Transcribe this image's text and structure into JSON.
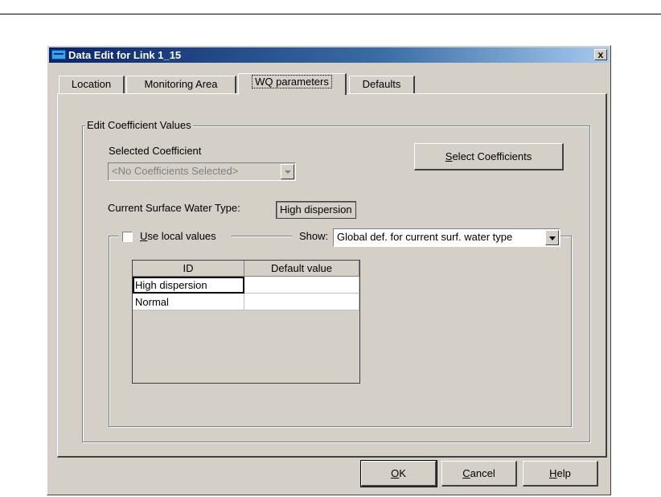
{
  "window": {
    "title": "Data Edit for Link 1_15",
    "close_label": "x"
  },
  "tabs": [
    {
      "label": "Location"
    },
    {
      "label": "Monitoring Area"
    },
    {
      "label": "WQ parameters"
    },
    {
      "label": "Defaults"
    }
  ],
  "active_tab": "WQ parameters",
  "edit_group": {
    "label": "Edit Coefficient Values"
  },
  "selected_coefficient": {
    "label": "Selected Coefficient",
    "value": "<No Coefficients Selected>"
  },
  "select_coefficients_button": {
    "mnemonic": "S",
    "rest": "elect Coefficients"
  },
  "surface_type": {
    "label": "Current Surface Water Type:",
    "value": "High dispersion"
  },
  "use_local": {
    "mnemonic": "U",
    "rest": "se local values",
    "checked": false
  },
  "show": {
    "label": "Show:",
    "value": "Global def. for current surf. water type"
  },
  "table": {
    "columns": [
      "ID",
      "Default value"
    ],
    "rows": [
      {
        "id": "High dispersion",
        "default_value": ""
      },
      {
        "id": "Normal",
        "default_value": ""
      }
    ]
  },
  "buttons": {
    "ok": {
      "mnemonic": "O",
      "rest": "K"
    },
    "cancel": {
      "mnemonic": "C",
      "rest": "ancel"
    },
    "help": {
      "mnemonic": "H",
      "rest": "elp"
    }
  }
}
